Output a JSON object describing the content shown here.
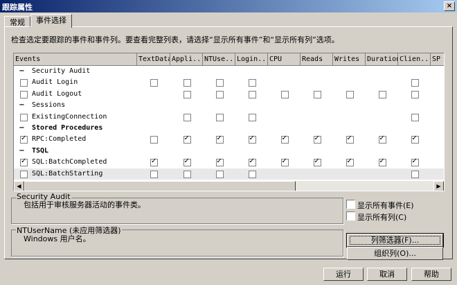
{
  "window": {
    "title": "跟踪属性",
    "close_icon": "×"
  },
  "tabs": [
    {
      "label": "常规"
    },
    {
      "label": "事件选择"
    }
  ],
  "hint": "检查选定要跟踪的事件和事件列。要查看完整列表，请选择“显示所有事件”和“显示所有列”选项。",
  "grid": {
    "columns": [
      "Events",
      "TextData",
      "Appli...",
      "NTUse...",
      "Login...",
      "CPU",
      "Reads",
      "Writes",
      "Duration",
      "Clien...",
      "SP"
    ],
    "rows": [
      {
        "label": "Security Audit",
        "type": "category",
        "state": "−",
        "cells": []
      },
      {
        "label": "Audit Login",
        "type": "event",
        "checked": false,
        "cells": [
          "off",
          "off",
          "off",
          "off",
          "",
          "",
          "",
          "",
          "off"
        ]
      },
      {
        "label": "Audit Logout",
        "type": "event",
        "checked": false,
        "cells": [
          "",
          "off",
          "off",
          "off",
          "off",
          "off",
          "off",
          "off",
          "off"
        ]
      },
      {
        "label": "Sessions",
        "type": "category",
        "state": "−",
        "cells": []
      },
      {
        "label": "ExistingConnection",
        "type": "event",
        "checked": false,
        "cells": [
          "",
          "off",
          "off",
          "off",
          "",
          "",
          "",
          "",
          "off"
        ]
      },
      {
        "label": "Stored Procedures",
        "type": "category",
        "state": "−",
        "bold": true,
        "cells": []
      },
      {
        "label": "RPC:Completed",
        "type": "event",
        "checked": true,
        "cells": [
          "off",
          "on",
          "on",
          "on",
          "on",
          "on",
          "on",
          "on",
          "on"
        ]
      },
      {
        "label": "TSQL",
        "type": "category",
        "state": "−",
        "bold": true,
        "cells": []
      },
      {
        "label": "SQL:BatchCompleted",
        "type": "event",
        "checked": true,
        "cells": [
          "on",
          "on",
          "on",
          "on",
          "on",
          "on",
          "on",
          "on",
          "on"
        ]
      },
      {
        "label": "SQL:BatchStarting",
        "type": "event",
        "checked": false,
        "selected": true,
        "cells": [
          "off",
          "off",
          "off",
          "off",
          "",
          "",
          "",
          "",
          "off"
        ]
      }
    ]
  },
  "event_desc": {
    "title": "Security Audit",
    "text": "包括用于审核服务器活动的事件类。"
  },
  "column_desc": {
    "title": "NTUserName (未应用筛选器)",
    "text": "Windows 用户名。"
  },
  "options": {
    "show_all_events": "显示所有事件(E)",
    "show_all_columns": "显示所有列(C)"
  },
  "buttons": {
    "column_filters": "列筛选器(F)...",
    "organize_columns": "组织列(O)...",
    "run": "运行",
    "cancel": "取消",
    "help": "帮助"
  }
}
